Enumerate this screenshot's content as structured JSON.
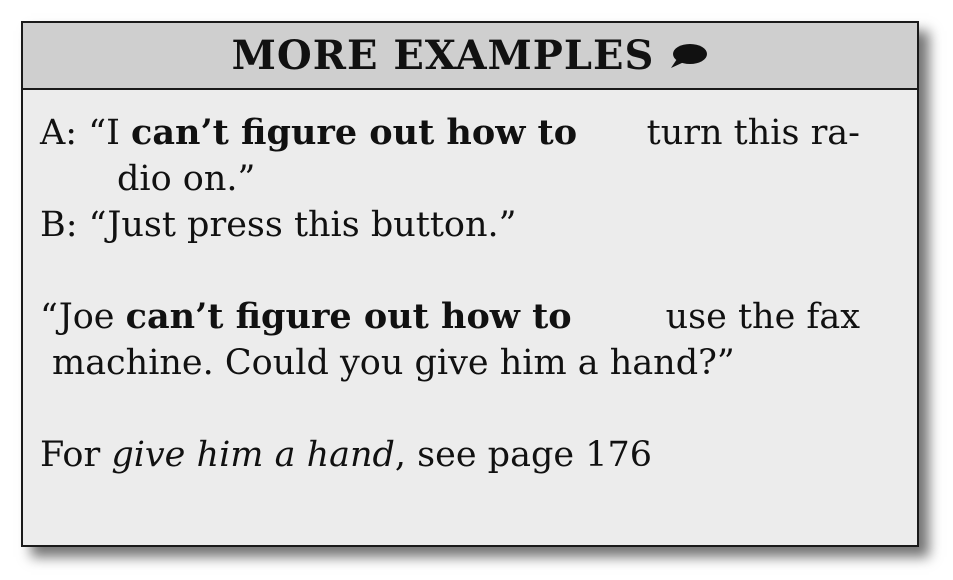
{
  "header": {
    "title": "MORE EXAMPLES",
    "icon": "speech-bubble-icon"
  },
  "example1": {
    "a_prefix": "A: “I ",
    "a_bold": "can’t figure out how to",
    "a_rest": " turn this ra-",
    "a_cont": "dio on.”",
    "b_line": "B: “Just press this button.”"
  },
  "example2": {
    "prefix": "“Joe ",
    "bold": "can’t figure out how to",
    "rest": " use the fax",
    "cont": "machine. Could you give him a hand?”"
  },
  "reference": {
    "prefix": "For ",
    "italic": "give him a hand",
    "suffix": ", see page 176"
  }
}
